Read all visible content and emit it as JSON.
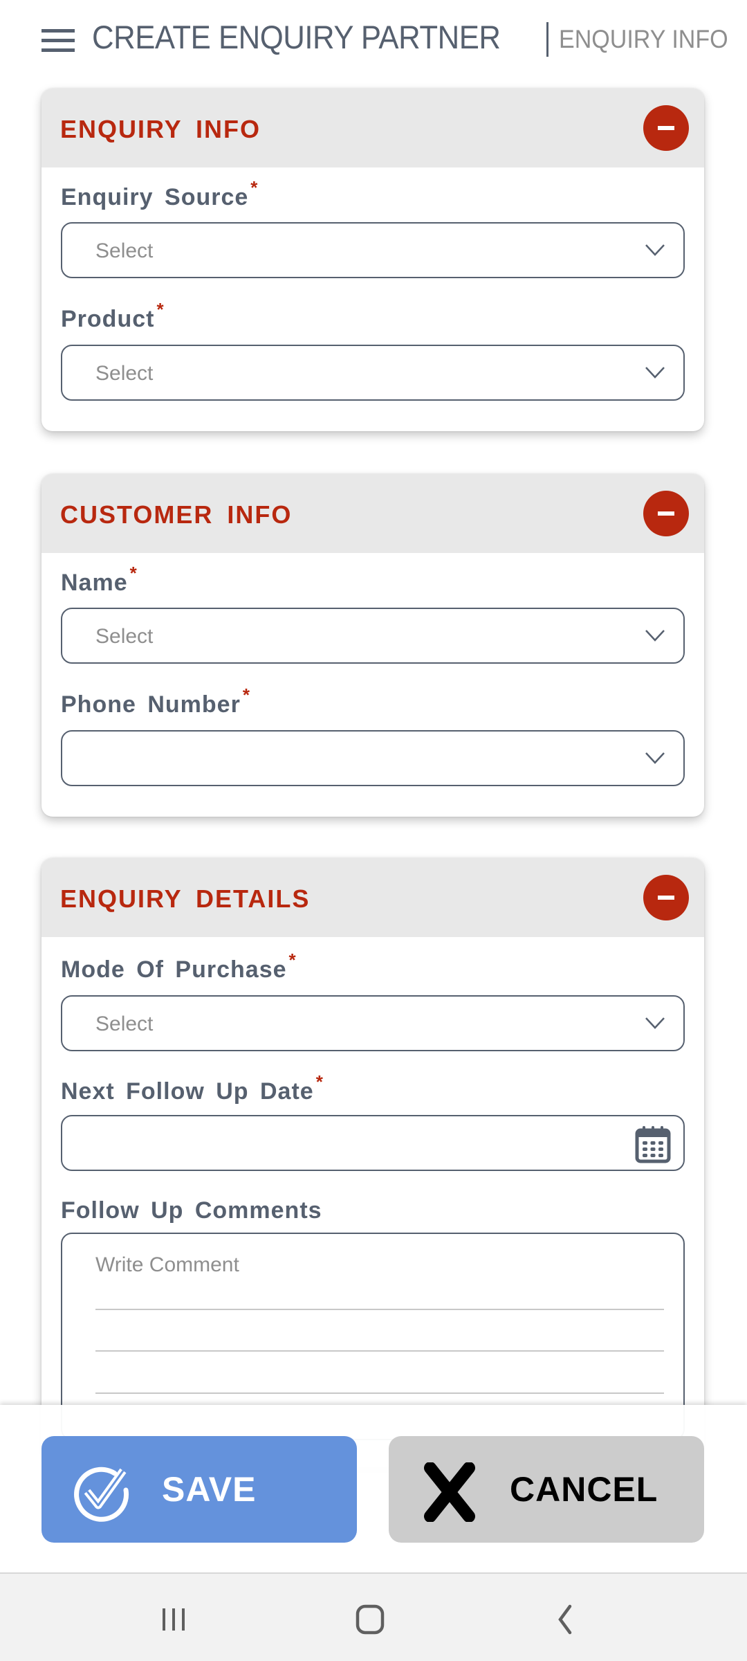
{
  "header": {
    "title": "CREATE ENQUIRY PARTNER",
    "subtitle": "ENQUIRY INFO",
    "menu_icon": "hamburger-menu-icon"
  },
  "sections": [
    {
      "title": "ENQUIRY INFO",
      "collapse_icon": "minus-circle-icon",
      "fields": [
        {
          "label": "Enquiry Source",
          "required": "*",
          "type": "select",
          "placeholder": "Select"
        },
        {
          "label": "Product",
          "required": "*",
          "type": "select",
          "placeholder": "Select"
        }
      ]
    },
    {
      "title": "CUSTOMER INFO",
      "collapse_icon": "minus-circle-icon",
      "fields": [
        {
          "label": "Name",
          "required": "*",
          "type": "select",
          "placeholder": "Select"
        },
        {
          "label": "Phone Number",
          "required": "*",
          "type": "select",
          "placeholder": ""
        }
      ]
    },
    {
      "title": "ENQUIRY DETAILS",
      "collapse_icon": "minus-circle-icon",
      "fields": [
        {
          "label": "Mode Of Purchase",
          "required": "*",
          "type": "select",
          "placeholder": "Select"
        },
        {
          "label": "Next Follow Up Date",
          "required": "*",
          "type": "date",
          "placeholder": ""
        },
        {
          "label": "Follow Up Comments",
          "required": "",
          "type": "textarea",
          "placeholder": "Write Comment"
        }
      ]
    }
  ],
  "actions": {
    "save_label": "SAVE",
    "cancel_label": "CANCEL"
  },
  "system_nav": [
    "recent-apps",
    "home",
    "back"
  ],
  "colors": {
    "accent_red": "#b8280f",
    "text_slate": "#56606f",
    "save_blue": "#6492dc",
    "cancel_gray": "#cccccc",
    "header_band": "#e8e8e8"
  }
}
